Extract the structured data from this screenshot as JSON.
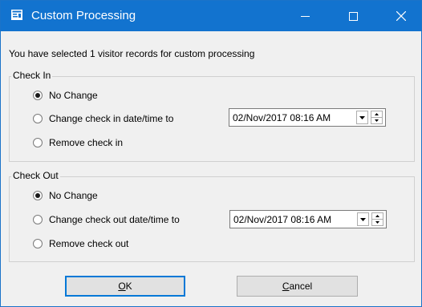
{
  "window": {
    "title": "Custom Processing",
    "icon": "form-window-icon",
    "controls": [
      "minimize-icon",
      "maximize-icon",
      "close-icon"
    ]
  },
  "intro_text": "You have selected 1 visitor records for custom processing",
  "check_in": {
    "legend": "Check In",
    "options": [
      {
        "label": "No Change",
        "checked": true
      },
      {
        "label": "Change check in date/time to",
        "checked": false
      },
      {
        "label": "Remove check in",
        "checked": false
      }
    ],
    "datetime_value": "02/Nov/2017 08:16 AM"
  },
  "check_out": {
    "legend": "Check Out",
    "options": [
      {
        "label": "No Change",
        "checked": true
      },
      {
        "label": "Change check out date/time to",
        "checked": false
      },
      {
        "label": "Remove check out",
        "checked": false
      }
    ],
    "datetime_value": "02/Nov/2017 08:16 AM"
  },
  "buttons": {
    "ok_mnemonic": "O",
    "ok_rest": "K",
    "cancel_mnemonic": "C",
    "cancel_rest": "ancel"
  },
  "colors": {
    "titlebar": "#1273cf",
    "dialog_bg": "#f0f0f0",
    "focus_border": "#0078d7"
  }
}
